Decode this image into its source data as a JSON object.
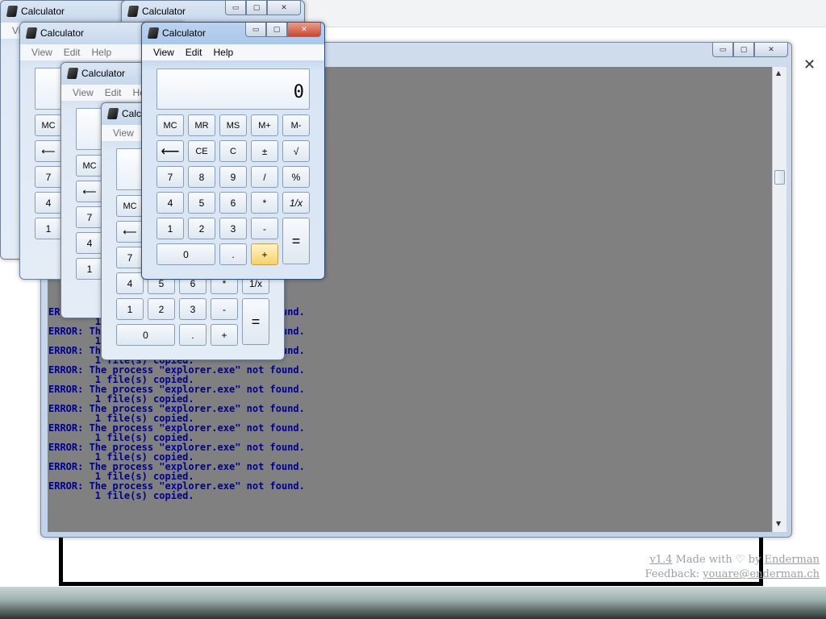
{
  "app_title": "Calculator",
  "menu": [
    "View",
    "Edit",
    "Help"
  ],
  "display_value": "0",
  "keys": {
    "memory": [
      "MC",
      "MR",
      "MS",
      "M+",
      "M-"
    ],
    "row2": [
      "⟵",
      "CE",
      "C",
      "±",
      "√"
    ],
    "row3": [
      "7",
      "8",
      "9",
      "/",
      "%"
    ],
    "row4": [
      "4",
      "5",
      "6",
      "*",
      "1/x"
    ],
    "row5": [
      "1",
      "2",
      "3",
      "-"
    ],
    "row6": [
      "0",
      ".",
      "+"
    ],
    "equals": "="
  },
  "window_controls": {
    "minimize": "▭",
    "maximize": "▢",
    "close": "✕"
  },
  "console_lines": [
    "ERROR: The process \"explorer.exe\" not found.",
    "        1 file(s) copied.",
    "ERROR: The process \"explorer.exe\" not found.",
    "        1 file(s) copied.",
    "ERROR: The process \"explorer.exe\" not found.",
    "        1 file(s) copied.",
    "ERROR: The process \"explorer.exe\" not found.",
    "        1 file(s) copied.",
    "ERROR: The process \"explorer.exe\" not found.",
    "        1 file(s) copied.",
    "ERROR: The process \"explorer.exe\" not found.",
    "        1 file(s) copied.",
    "ERROR: The process \"explorer.exe\" not found.",
    "        1 file(s) copied.",
    "ERROR: The process \"explorer.exe\" not found.",
    "        1 file(s) copied.",
    "ERROR: The process \"explorer.exe\" not found.",
    "        1 file(s) copied.",
    "ERROR: The process \"explorer.exe\" not found.",
    "        1 file(s) copied."
  ],
  "footer": {
    "version": "v1.4",
    "made_with": "Made with",
    "by": "by",
    "author": "Enderman",
    "feedback_label": "Feedback:",
    "feedback_email": "youare@enderman.ch"
  },
  "background_close": "✕",
  "colors": {
    "console_text": "#00008b",
    "console_bg": "#808080",
    "hot_button": "#f6d16b",
    "close_button": "#c9462c"
  }
}
